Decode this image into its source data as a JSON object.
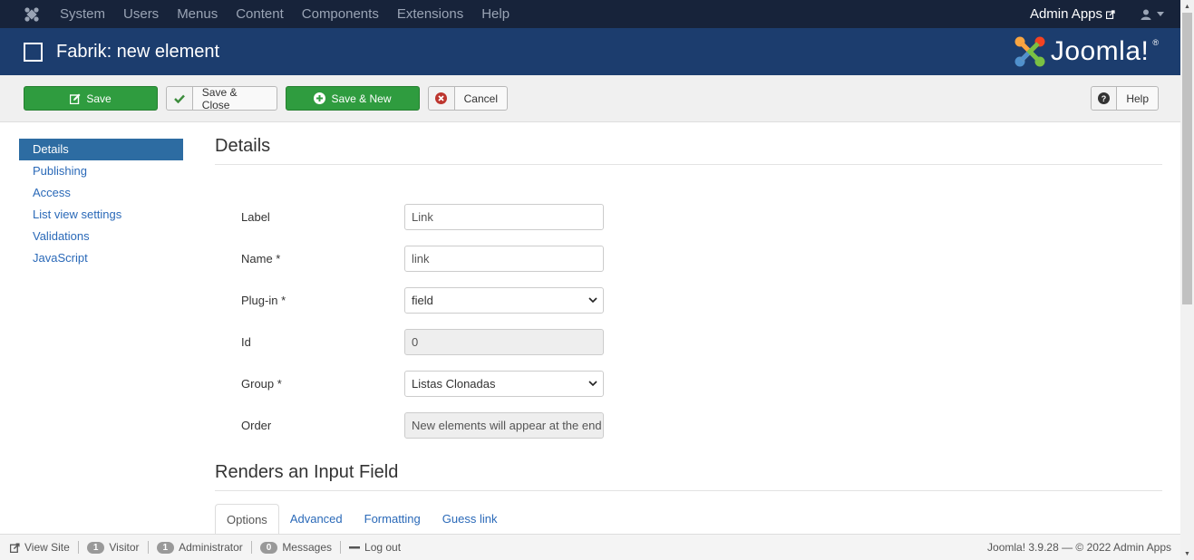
{
  "topnav": {
    "menu": [
      "System",
      "Users",
      "Menus",
      "Content",
      "Components",
      "Extensions",
      "Help"
    ],
    "site_name": "Admin Apps"
  },
  "header": {
    "title": "Fabrik: new element",
    "brand": "Joomla!",
    "brand_mark": "®"
  },
  "toolbar": {
    "save": "Save",
    "save_close": "Save & Close",
    "save_new": "Save & New",
    "cancel": "Cancel",
    "help": "Help"
  },
  "sidebar": {
    "items": [
      {
        "label": "Details",
        "active": true
      },
      {
        "label": "Publishing"
      },
      {
        "label": "Access"
      },
      {
        "label": "List view settings"
      },
      {
        "label": "Validations"
      },
      {
        "label": "JavaScript"
      }
    ]
  },
  "main": {
    "section_title": "Details",
    "fields": {
      "label": {
        "label": "Label",
        "value": "Link"
      },
      "name": {
        "label": "Name *",
        "value": "link"
      },
      "plugin": {
        "label": "Plug-in *",
        "value": "field"
      },
      "id": {
        "label": "Id",
        "value": "0"
      },
      "group": {
        "label": "Group *",
        "value": "Listas Clonadas"
      },
      "order": {
        "label": "Order",
        "value": "New elements will appear at the end"
      }
    },
    "section2_title": "Renders an Input Field",
    "tabs": [
      "Options",
      "Advanced",
      "Formatting",
      "Guess link"
    ]
  },
  "status": {
    "view_site": "View Site",
    "visitor_count": "1",
    "visitor": "Visitor",
    "admin_count": "1",
    "admin": "Administrator",
    "msg_count": "0",
    "messages": "Messages",
    "logout": "Log out",
    "version": "Joomla! 3.9.28 — © 2022 Admin Apps"
  },
  "colors": {
    "topnav": "#17233a",
    "header": "#1c3d6e",
    "save_green": "#2f9c3f",
    "link": "#2a69b8",
    "active_side": "#2d6ca2"
  }
}
